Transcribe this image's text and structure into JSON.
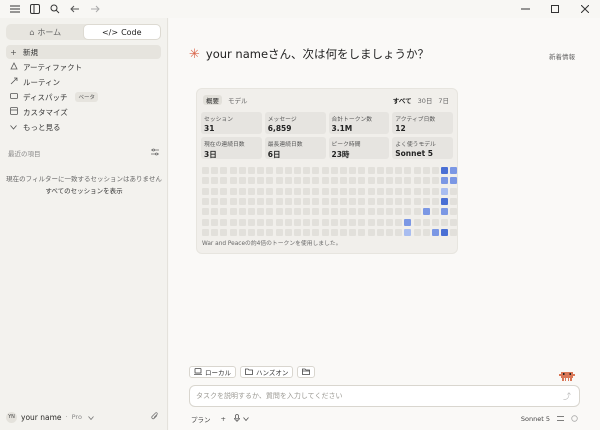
{
  "topbar": {
    "icons": [
      "menu-icon",
      "sidebar-toggle-icon",
      "search-icon",
      "back-arrow-icon",
      "forward-arrow-icon"
    ],
    "window_controls": [
      "minimize-icon",
      "maximize-icon",
      "close-icon"
    ]
  },
  "sidebar": {
    "tabs": [
      {
        "label": "ホーム",
        "icon": "home-icon",
        "active": false
      },
      {
        "label": "Code",
        "icon": "code-icon",
        "active": true
      }
    ],
    "nav": [
      {
        "label": "新規",
        "icon": "plus-icon"
      },
      {
        "label": "アーティファクト",
        "icon": "artifact-icon"
      },
      {
        "label": "ルーティン",
        "icon": "routine-icon"
      },
      {
        "label": "ディスパッチ",
        "icon": "dispatch-icon",
        "badge": "ベータ"
      },
      {
        "label": "カスタマイズ",
        "icon": "customize-icon"
      },
      {
        "label": "もっと見る",
        "icon": "chevron-down-icon"
      }
    ],
    "recent_heading": "最近の項目",
    "empty_message": "現在のフィルターに一致するセッションはありません",
    "show_all": "すべてのセッションを表示",
    "user": {
      "initials": "YN",
      "name": "your name",
      "plan": "Pro"
    }
  },
  "main": {
    "greeting": "your nameさん、次は何をしましょうか？",
    "news_link": "新着情報",
    "stats_card": {
      "tabs": [
        "概要",
        "モデル"
      ],
      "ranges": [
        "すべて",
        "30日",
        "7日"
      ],
      "stats": [
        {
          "label": "セッション",
          "value": "31"
        },
        {
          "label": "メッセージ",
          "value": "6,859"
        },
        {
          "label": "合計トークン数",
          "value": "3.1M"
        },
        {
          "label": "アクティブ日数",
          "value": "12"
        },
        {
          "label": "現在の連続日数",
          "value": "3日"
        },
        {
          "label": "最長連続日数",
          "value": "6日"
        },
        {
          "label": "ピーク時間",
          "value": "23時"
        },
        {
          "label": "よく使うモデル",
          "value": "Sonnet 5"
        }
      ],
      "heatmap_active": [
        {
          "col": 26,
          "row": 0,
          "level": 3
        },
        {
          "col": 27,
          "row": 0,
          "level": 2
        },
        {
          "col": 26,
          "row": 1,
          "level": 2
        },
        {
          "col": 27,
          "row": 1,
          "level": 2
        },
        {
          "col": 26,
          "row": 2,
          "level": 1
        },
        {
          "col": 26,
          "row": 3,
          "level": 3
        },
        {
          "col": 24,
          "row": 4,
          "level": 2
        },
        {
          "col": 26,
          "row": 4,
          "level": 2
        },
        {
          "col": 22,
          "row": 5,
          "level": 2
        },
        {
          "col": 22,
          "row": 6,
          "level": 1
        },
        {
          "col": 25,
          "row": 6,
          "level": 2
        },
        {
          "col": 26,
          "row": 6,
          "level": 3
        }
      ],
      "footer": "War and Peaceの約4倍のトークンを使用しました。"
    },
    "mode_buttons": [
      {
        "label": "ローカル",
        "icon": "laptop-icon"
      },
      {
        "label": "ハンズオン",
        "icon": "folder-icon"
      },
      {
        "label": "",
        "icon": "folder-open-icon"
      }
    ],
    "input_placeholder": "タスクを説明するか、質問を入力してください",
    "bottom": {
      "plan_label": "プラン",
      "model": "Sonnet 5"
    }
  }
}
